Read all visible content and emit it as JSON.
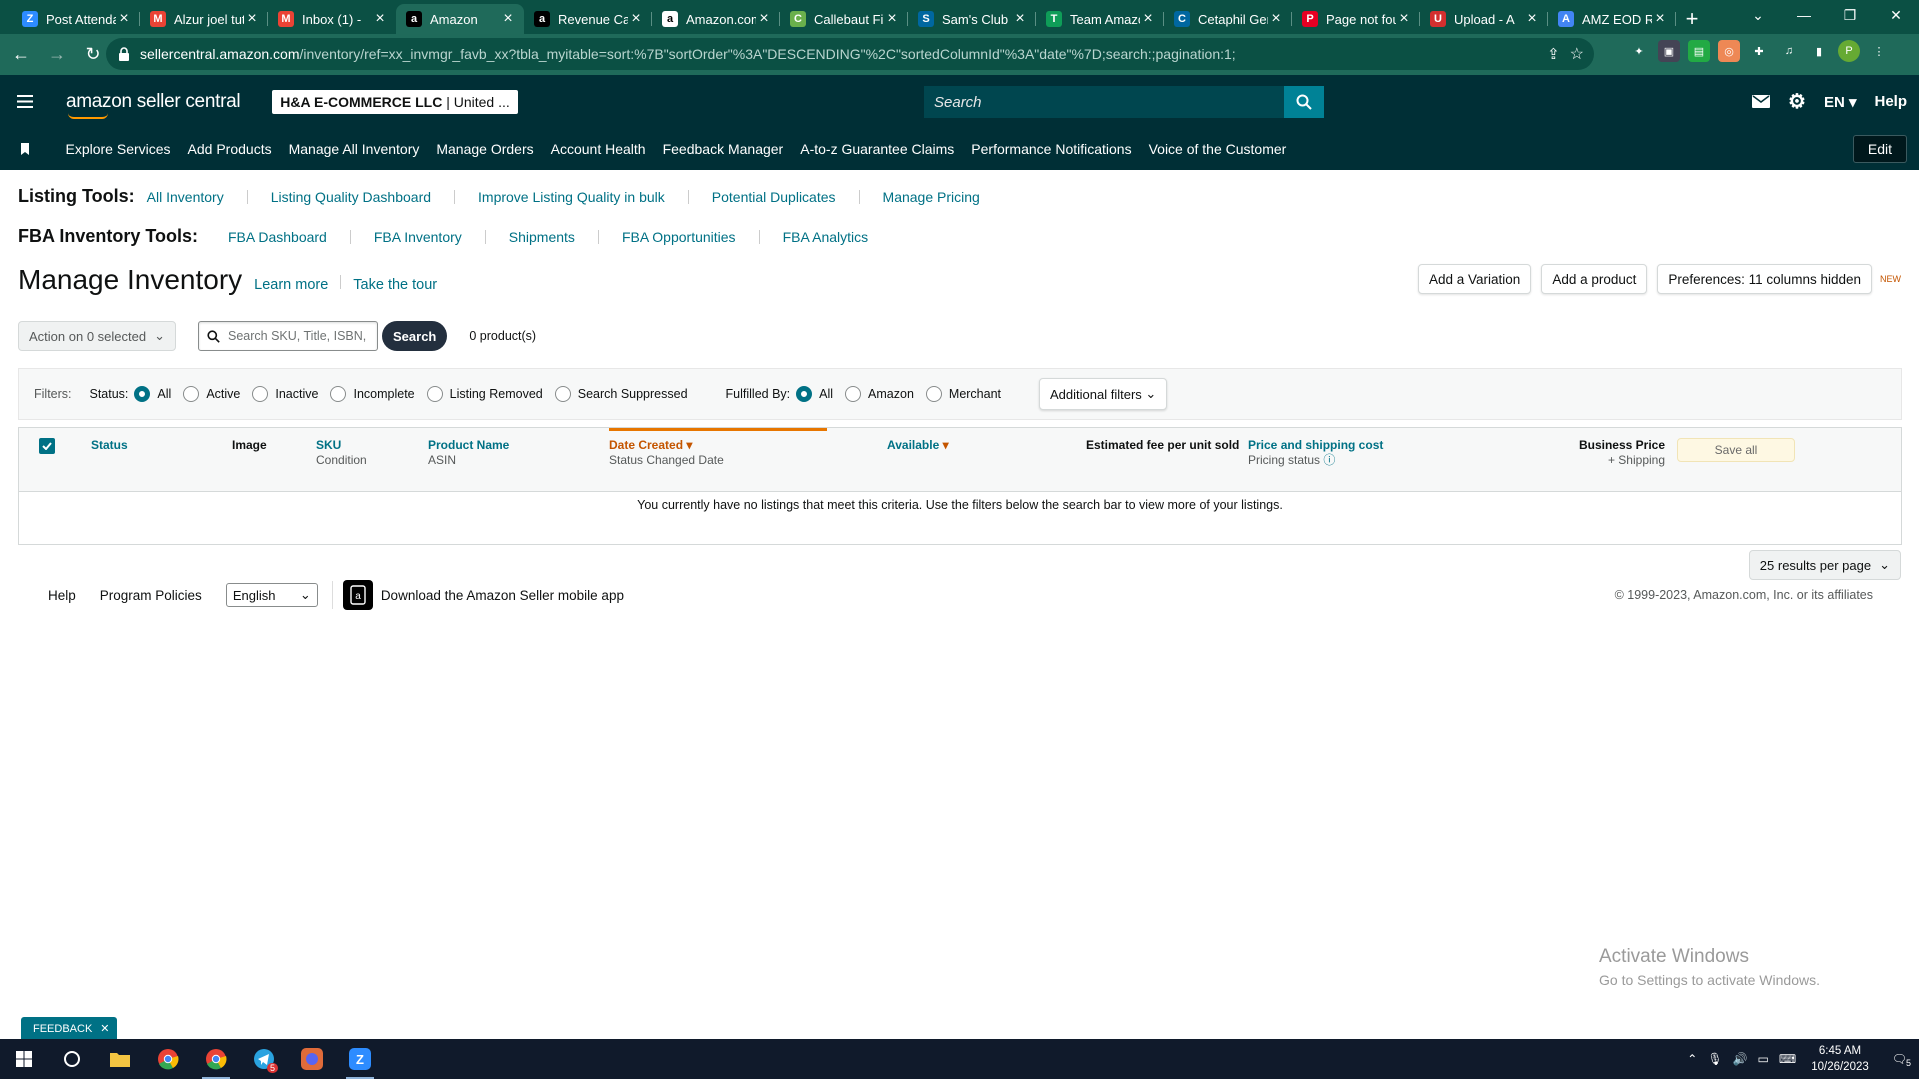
{
  "browser": {
    "tabs": [
      {
        "title": "Post Attendance",
        "icon": "Z",
        "color": "#2d8cff"
      },
      {
        "title": "Alzur joel tutorial",
        "icon": "M",
        "color": "#ea4335"
      },
      {
        "title": "Inbox (1) - ",
        "icon": "M",
        "color": "#ea4335"
      },
      {
        "title": "Amazon",
        "icon": "a",
        "color": "#000000",
        "active": true
      },
      {
        "title": "Revenue Calculator",
        "icon": "a",
        "color": "#000000"
      },
      {
        "title": "Amazon.com",
        "icon": "a",
        "color": "#ffffff"
      },
      {
        "title": "Callebaut Finest",
        "icon": "C",
        "color": "#6ab04c"
      },
      {
        "title": "Sam's Club",
        "icon": "S",
        "color": "#0067a0"
      },
      {
        "title": "Team Amazon",
        "icon": "T",
        "color": "#0f9d58"
      },
      {
        "title": "Cetaphil Gentle",
        "icon": "C",
        "color": "#0067a0"
      },
      {
        "title": "Page not found",
        "icon": "P",
        "color": "#e60023"
      },
      {
        "title": "Upload - A",
        "icon": "U",
        "color": "#d32f2f"
      },
      {
        "title": "AMZ EOD Report",
        "icon": "A",
        "color": "#4285f4"
      }
    ],
    "url_host": "sellercentral.amazon.com",
    "url_path": "/inventory/ref=xx_invmgr_favb_xx?tbla_myitable=sort:%7B\"sortOrder\"%3A\"DESCENDING\"%2C\"sortedColumnId\"%3A\"date\"%7D;search:;pagination:1;",
    "profile_initial": "P"
  },
  "header": {
    "logo": "amazon seller central",
    "account_name": "H&A E-COMMERCE LLC",
    "account_region": "United ...",
    "search_placeholder": "Search",
    "lang": "EN",
    "help": "Help"
  },
  "nav": {
    "items": [
      "Explore Services",
      "Add Products",
      "Manage All Inventory",
      "Manage Orders",
      "Account Health",
      "Feedback Manager",
      "A-to-z Guarantee Claims",
      "Performance Notifications",
      "Voice of the Customer"
    ],
    "edit": "Edit"
  },
  "listing_tools": {
    "label": "Listing Tools:",
    "links": [
      "All Inventory",
      "Listing Quality Dashboard",
      "Improve Listing Quality in bulk",
      "Potential Duplicates",
      "Manage Pricing"
    ]
  },
  "fba_tools": {
    "label": "FBA Inventory Tools:",
    "links": [
      "FBA Dashboard",
      "FBA Inventory",
      "Shipments",
      "FBA Opportunities",
      "FBA Analytics"
    ]
  },
  "page": {
    "title": "Manage Inventory",
    "learn_more": "Learn more",
    "tour": "Take the tour",
    "add_variation": "Add a Variation",
    "add_product": "Add a product",
    "preferences": "Preferences: 11 columns hidden",
    "new_tag": "NEW"
  },
  "actions": {
    "action_select": "Action on 0 selected",
    "search_placeholder": "Search SKU, Title, ISBN,",
    "search_button": "Search",
    "product_count": "0 product(s)"
  },
  "filters": {
    "label": "Filters:",
    "status_label": "Status:",
    "status_options": [
      "All",
      "Active",
      "Inactive",
      "Incomplete",
      "Listing Removed",
      "Search Suppressed"
    ],
    "status_selected": "All",
    "fulfilled_label": "Fulfilled By:",
    "fulfilled_options": [
      "All",
      "Amazon",
      "Merchant"
    ],
    "fulfilled_selected": "All",
    "additional": "Additional filters"
  },
  "table": {
    "columns": {
      "status": "Status",
      "image": "Image",
      "sku": "SKU",
      "sku_sub": "Condition",
      "product_name": "Product Name",
      "product_sub": "ASIN",
      "date_created": "Date Created",
      "date_sub": "Status Changed Date",
      "available": "Available",
      "fee": "Estimated fee per unit sold",
      "price": "Price and shipping cost",
      "price_sub": "Pricing status",
      "business_price": "Business Price",
      "business_sub": "+ Shipping"
    },
    "save_all": "Save all",
    "empty_message": "You currently have no listings that meet this criteria. Use the filters below the search bar to view more of your listings.",
    "per_page": "25 results per page"
  },
  "footer": {
    "help": "Help",
    "policies": "Program Policies",
    "language": "English",
    "app": "Download the Amazon Seller mobile app",
    "copyright": "© 1999-2023, Amazon.com, Inc. or its affiliates"
  },
  "watermark": {
    "line1": "Activate Windows",
    "line2": "Go to Settings to activate Windows."
  },
  "feedback": "FEEDBACK",
  "taskbar": {
    "time": "6:45 AM",
    "date": "10/26/2023",
    "notif_count": "5",
    "telegram_badge": "5"
  },
  "colors": {
    "header_bg": "#002f36",
    "link": "#007185",
    "sort_accent": "#e77600",
    "browser_bg": "#0b5044"
  }
}
